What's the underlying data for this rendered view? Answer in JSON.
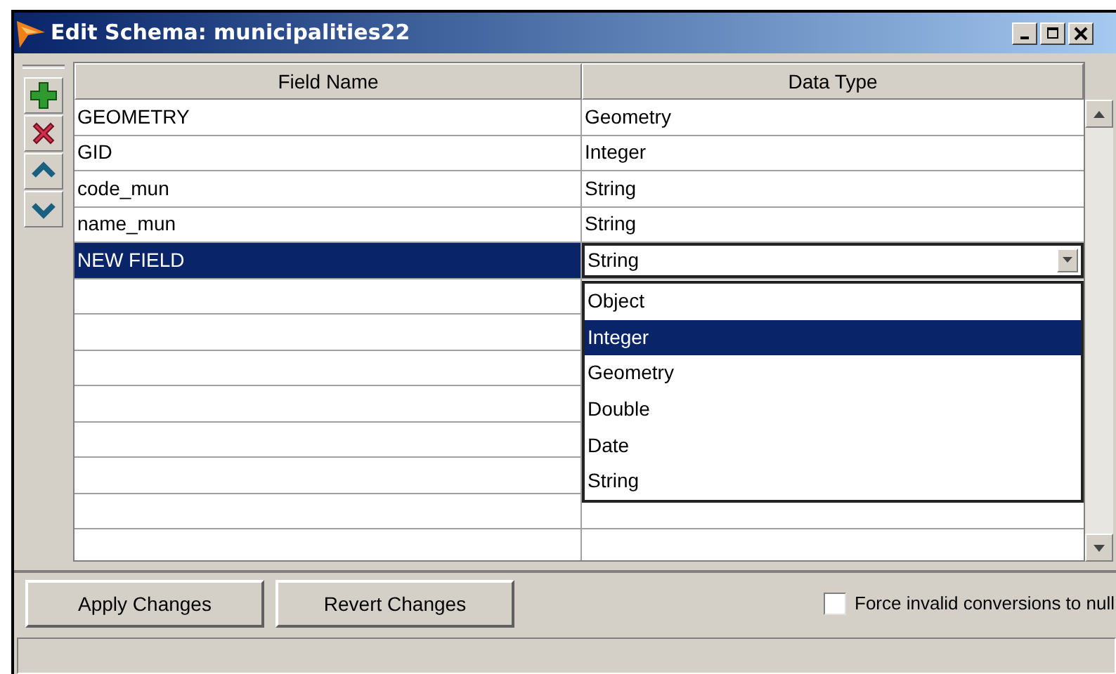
{
  "window": {
    "title": "Edit Schema: municipalities22",
    "controls": [
      {
        "kind": "minimize"
      },
      {
        "kind": "maximize"
      },
      {
        "kind": "close"
      }
    ]
  },
  "toolbar": [
    {
      "kind": "add"
    },
    {
      "kind": "delete"
    },
    {
      "kind": "up"
    },
    {
      "kind": "down"
    }
  ],
  "table": {
    "columns": [
      "Field Name",
      "Data Type"
    ],
    "rows": [
      {
        "name": "GEOMETRY",
        "type": "Geometry",
        "selected": false
      },
      {
        "name": "GID",
        "type": "Integer",
        "selected": false
      },
      {
        "name": "code_mun",
        "type": "String",
        "selected": false
      },
      {
        "name": "name_mun",
        "type": "String",
        "selected": false
      },
      {
        "name": "NEW FIELD",
        "type": "String",
        "selected": true
      }
    ]
  },
  "dropdown": {
    "options": [
      {
        "label": "Object",
        "selected": false
      },
      {
        "label": "Integer",
        "selected": true
      },
      {
        "label": "Geometry",
        "selected": false
      },
      {
        "label": "Double",
        "selected": false
      },
      {
        "label": "Date",
        "selected": false
      },
      {
        "label": "String",
        "selected": false
      }
    ]
  },
  "buttons": [
    "Apply Changes",
    "Revert Changes"
  ],
  "checkbox": {
    "label": "Force invalid conversions to null",
    "checked": false
  }
}
